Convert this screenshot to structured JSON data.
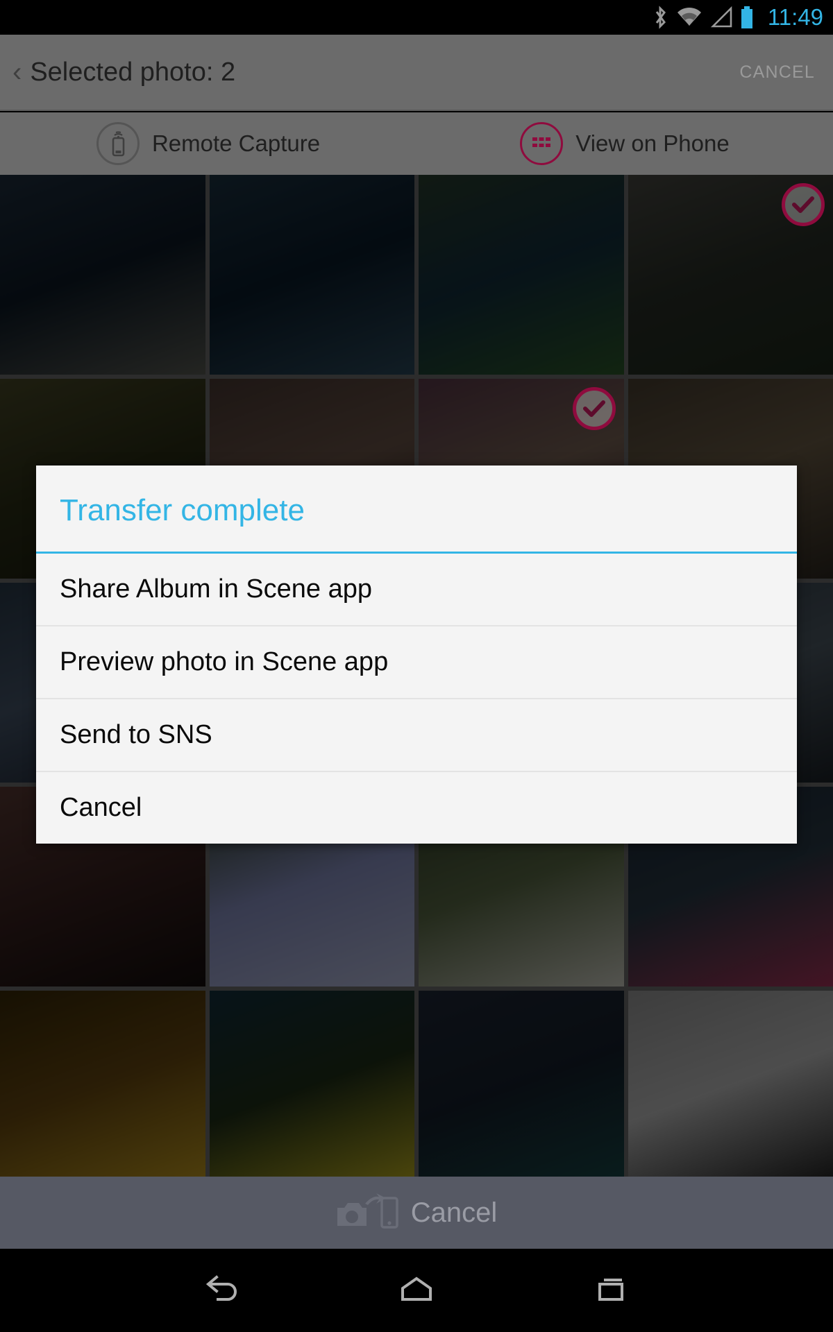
{
  "status_bar": {
    "icons": [
      "bluetooth-icon",
      "wifi-icon",
      "signal-icon",
      "battery-icon"
    ],
    "clock": "11:49",
    "accent_color": "#33b5e5"
  },
  "action_bar": {
    "back_caret": "‹",
    "title": "Selected photo: 2",
    "cancel_label": "CANCEL"
  },
  "tabs": [
    {
      "label": "Remote Capture",
      "icon": "phone-signal-icon",
      "active": false
    },
    {
      "label": "View on Phone",
      "icon": "grid-view-icon",
      "active": true
    }
  ],
  "tab_accent_color": "#8f0b3e",
  "grid": {
    "rows": 5,
    "columns": 4,
    "cells": [
      {
        "name": "cliff-over-sea-photo",
        "selected": false,
        "c1": "#203040",
        "c2": "#0d1a26",
        "c3": "#5a5c55"
      },
      {
        "name": "fjord-mountain-photo",
        "selected": false,
        "c1": "#1d3444",
        "c2": "#0a1c2b",
        "c3": "#2c4a5c"
      },
      {
        "name": "island-bay-photo",
        "selected": false,
        "c1": "#2a4030",
        "c2": "#13303f",
        "c3": "#2d5a2a"
      },
      {
        "name": "coastal-ruins-photo",
        "selected": true,
        "c1": "#4a4a44",
        "c2": "#2a3028",
        "c3": "#1e2a1c"
      },
      {
        "name": "vineyard-field-photo",
        "selected": false,
        "c1": "#4a4a28",
        "c2": "#2c2f16",
        "c3": "#1a1c0e"
      },
      {
        "name": "cauliflower-market-photo",
        "selected": false,
        "c1": "#4b3a34",
        "c2": "#6a5448",
        "c3": "#2a1f1a"
      },
      {
        "name": "onion-produce-photo",
        "selected": true,
        "c1": "#5b3a4a",
        "c2": "#7a6456",
        "c3": "#3a2430"
      },
      {
        "name": "dog-on-bridge-photo",
        "selected": false,
        "c1": "#4a4032",
        "c2": "#6b5c46",
        "c3": "#2e2820"
      },
      {
        "name": "boat-marina-photo",
        "selected": false,
        "c1": "#2a3a4a",
        "c2": "#46566a",
        "c3": "#1a2230"
      },
      {
        "name": "harbor-dock-photo",
        "selected": false,
        "c1": "#3a4452",
        "c2": "#566070",
        "c3": "#20262e"
      },
      {
        "name": "lake-shore-photo",
        "selected": false,
        "c1": "#2c3c46",
        "c2": "#46545e",
        "c3": "#161e24"
      },
      {
        "name": "rocky-coast-photo",
        "selected": false,
        "c1": "#34404a",
        "c2": "#4e5a64",
        "c3": "#1c2228"
      },
      {
        "name": "sunset-silhouette-photo",
        "selected": false,
        "c1": "#5a3a34",
        "c2": "#3a2220",
        "c3": "#140d0c"
      },
      {
        "name": "pansy-flowers-photo",
        "selected": false,
        "c1": "#2a3a1e",
        "c2": "#8a92c4",
        "c3": "#b8bede"
      },
      {
        "name": "terrier-in-grass-photo",
        "selected": false,
        "c1": "#34402a",
        "c2": "#5a6a46",
        "c3": "#cfcfc4"
      },
      {
        "name": "tulip-field-photo",
        "selected": false,
        "c1": "#1c2838",
        "c2": "#2a3a46",
        "c3": "#a8345a"
      },
      {
        "name": "sunflower-macro-photo",
        "selected": false,
        "c1": "#3a2a08",
        "c2": "#6a4a10",
        "c3": "#c8a020"
      },
      {
        "name": "sunflower-field-photo",
        "selected": false,
        "c1": "#13303f",
        "c2": "#203018",
        "c3": "#c8b820"
      },
      {
        "name": "night-sea-photo",
        "selected": false,
        "c1": "#202838",
        "c2": "#16202c",
        "c3": "#184a4a"
      },
      {
        "name": "seagull-on-sand-photo",
        "selected": false,
        "c1": "#9a9a9a",
        "c2": "#c0c0c0",
        "c3": "#1a1a1a"
      }
    ]
  },
  "dialog": {
    "title": "Transfer complete",
    "title_color": "#33b5e5",
    "items": [
      {
        "label": "Share Album in Scene app",
        "name": "share-album-item"
      },
      {
        "label": "Preview photo in Scene app",
        "name": "preview-photo-item"
      },
      {
        "label": "Send to SNS",
        "name": "send-to-sns-item"
      },
      {
        "label": "Cancel",
        "name": "dialog-cancel-item"
      }
    ]
  },
  "bottom_bar": {
    "icon": "camera-to-phone-transfer-icon",
    "label": "Cancel"
  },
  "nav_bar": {
    "buttons": [
      {
        "name": "nav-back-button",
        "icon": "back-arrow-icon"
      },
      {
        "name": "nav-home-button",
        "icon": "home-icon"
      },
      {
        "name": "nav-recents-button",
        "icon": "recents-icon"
      }
    ]
  }
}
